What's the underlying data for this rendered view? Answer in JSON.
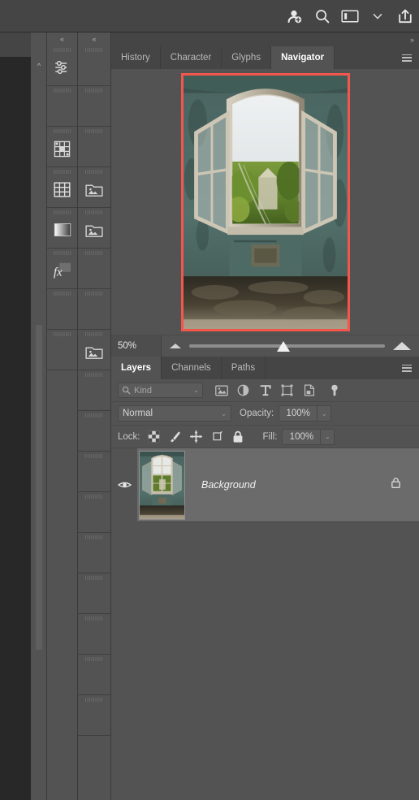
{
  "app": {
    "title": "Adobe Photoshop",
    "theme_bg": "#535353",
    "topbar_bg": "#454545",
    "accent_red": "#f4564b",
    "selected_layer_bg": "#6b6b6b"
  },
  "topbar": {
    "icons": [
      {
        "name": "add-user-icon",
        "label": "Add user",
        "glyph": "person-plus"
      },
      {
        "name": "search-icon",
        "label": "Search",
        "glyph": "magnifier"
      },
      {
        "name": "workspace-icon",
        "label": "Workspace",
        "glyph": "panel"
      },
      {
        "name": "chevron-down-icon",
        "label": "Workspace options",
        "glyph": "chevron-down"
      },
      {
        "name": "share-icon",
        "label": "Share",
        "glyph": "share-up"
      }
    ]
  },
  "gutter": {
    "collapse_glyph": "^"
  },
  "icon_columns": {
    "collapse_glyph": "«",
    "column_one": [
      {
        "name": "adjustments-icon",
        "label": "Adjustments",
        "glyph": "sliders",
        "has_icon": true
      },
      {
        "name": "empty-dock-slot",
        "label": "",
        "glyph": "",
        "has_icon": false
      },
      {
        "name": "properties-icon",
        "label": "Properties",
        "glyph": "grid-nodes",
        "has_icon": true
      },
      {
        "name": "swatches-icon",
        "label": "Swatches",
        "glyph": "table-grid",
        "has_icon": true
      },
      {
        "name": "gradients-icon",
        "label": "Gradients",
        "glyph": "gradient-square",
        "has_icon": true
      },
      {
        "name": "styles-icon",
        "label": "Styles",
        "glyph": "fx",
        "has_icon": true
      },
      {
        "name": "empty-dock-slot",
        "label": "",
        "glyph": "",
        "has_icon": false
      },
      {
        "name": "empty-dock-slot",
        "label": "",
        "glyph": "",
        "has_icon": false
      }
    ],
    "column_two": [
      {
        "name": "empty-dock-slot",
        "label": "",
        "glyph": "",
        "has_icon": false
      },
      {
        "name": "empty-dock-slot",
        "label": "",
        "glyph": "",
        "has_icon": false
      },
      {
        "name": "empty-dock-slot",
        "label": "",
        "glyph": "",
        "has_icon": false
      },
      {
        "name": "libraries-icon",
        "label": "Libraries",
        "glyph": "folder-image",
        "has_icon": true
      },
      {
        "name": "libraries-icon-2",
        "label": "Libraries",
        "glyph": "folder-image",
        "has_icon": true
      },
      {
        "name": "empty-dock-slot",
        "label": "",
        "glyph": "",
        "has_icon": false
      },
      {
        "name": "empty-dock-slot",
        "label": "",
        "glyph": "",
        "has_icon": false
      },
      {
        "name": "libraries-icon-3",
        "label": "Libraries",
        "glyph": "folder-image",
        "has_icon": true
      },
      {
        "name": "empty-dock-slot",
        "label": "",
        "glyph": "",
        "has_icon": false
      },
      {
        "name": "empty-dock-slot",
        "label": "",
        "glyph": "",
        "has_icon": false
      },
      {
        "name": "empty-dock-slot",
        "label": "",
        "glyph": "",
        "has_icon": false
      },
      {
        "name": "empty-dock-slot",
        "label": "",
        "glyph": "",
        "has_icon": false
      },
      {
        "name": "empty-dock-slot",
        "label": "",
        "glyph": "",
        "has_icon": false
      },
      {
        "name": "empty-dock-slot",
        "label": "",
        "glyph": "",
        "has_icon": false
      },
      {
        "name": "empty-dock-slot",
        "label": "",
        "glyph": "",
        "has_icon": false
      },
      {
        "name": "empty-dock-slot",
        "label": "",
        "glyph": "",
        "has_icon": false
      },
      {
        "name": "empty-dock-slot",
        "label": "",
        "glyph": "",
        "has_icon": false
      }
    ]
  },
  "top_panel": {
    "expand_glyph": "»",
    "tabs": [
      {
        "label": "History",
        "active": false
      },
      {
        "label": "Character",
        "active": false
      },
      {
        "label": "Glyphs",
        "active": false
      },
      {
        "label": "Navigator",
        "active": true
      }
    ],
    "menu_label": "Panel menu"
  },
  "navigator": {
    "zoom_value": "50%",
    "zoom_out_label": "Zoom out",
    "zoom_in_label": "Zoom in",
    "slider_position_percent": 45,
    "view_box_color": "#f4564b",
    "image_alt": "Derelict room with open arched window overlooking green trees"
  },
  "layers_panel": {
    "tabs": [
      {
        "label": "Layers",
        "active": true
      },
      {
        "label": "Channels",
        "active": false
      },
      {
        "label": "Paths",
        "active": false
      }
    ],
    "menu_label": "Panel menu",
    "filter": {
      "search_icon": "search-icon",
      "kind_value": "Kind",
      "caret": "⌄",
      "type_filters": [
        {
          "name": "filter-pixel-icon",
          "label": "Pixel layers"
        },
        {
          "name": "filter-adjustment-icon",
          "label": "Adjustment layers"
        },
        {
          "name": "filter-type-icon",
          "label": "Type layers"
        },
        {
          "name": "filter-shape-icon",
          "label": "Shape layers"
        },
        {
          "name": "filter-smart-object-icon",
          "label": "Smart objects"
        }
      ],
      "toggle_label": "Toggle filtering"
    },
    "blend": {
      "mode_value": "Normal",
      "caret": "⌄",
      "opacity_label": "Opacity:",
      "opacity_value": "100%"
    },
    "lock": {
      "label": "Lock:",
      "buttons": [
        {
          "name": "lock-transparent-pixels-icon",
          "label": "Lock transparent pixels"
        },
        {
          "name": "lock-image-pixels-icon",
          "label": "Lock image pixels"
        },
        {
          "name": "lock-position-icon",
          "label": "Lock position"
        },
        {
          "name": "lock-artboard-nesting-icon",
          "label": "Prevent auto-nesting"
        },
        {
          "name": "lock-all-icon",
          "label": "Lock all"
        }
      ],
      "fill_label": "Fill:",
      "fill_value": "100%"
    },
    "layers": [
      {
        "name": "Background",
        "visible": true,
        "locked": true,
        "selected": true,
        "thumbnail_alt": "Derelict room with open arched window"
      }
    ]
  }
}
